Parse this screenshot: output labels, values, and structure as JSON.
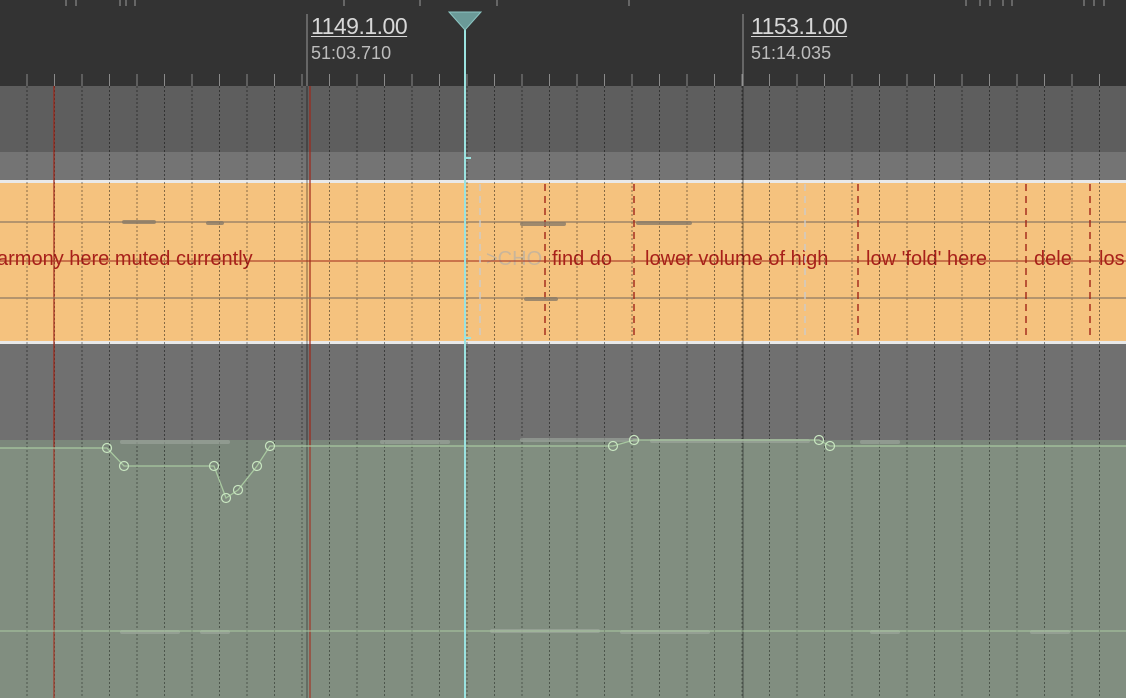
{
  "ruler": {
    "markers": [
      {
        "bar": "1149.1.00",
        "time": "51:03.710"
      },
      {
        "bar": "1153.1.00",
        "time": "51:14.035"
      }
    ]
  },
  "notes": [
    {
      "text": "armony here muted currently"
    },
    {
      "text": ">CHO"
    },
    {
      "text": "find do"
    },
    {
      "text": "lower volume of high"
    },
    {
      "text": "low 'fold' here"
    },
    {
      "text": "dele"
    },
    {
      "text": "los"
    }
  ],
  "colors": {
    "ruler_bg": "#333333",
    "note_lane": "#f5c27e",
    "note_text": "#a8201a",
    "playhead": "#9be3e0",
    "envelope_lane": "#7b877b",
    "envelope_line": "#a8c8a0"
  }
}
